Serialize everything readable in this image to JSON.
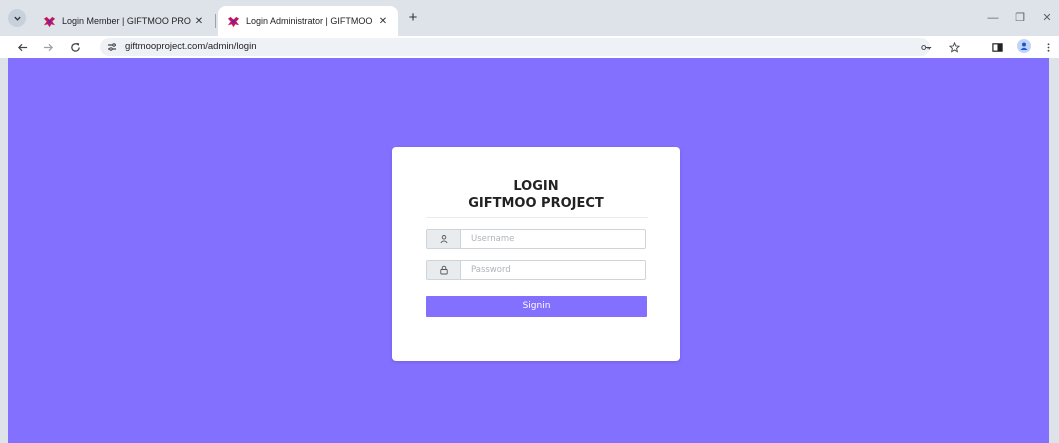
{
  "browser": {
    "tabs": [
      {
        "title": "Login Member | GIFTMOO PRO",
        "active": false,
        "close": "✕"
      },
      {
        "title": "Login Administrator | GIFTMOO",
        "active": true,
        "close": "✕"
      }
    ],
    "new_tab": "+",
    "address": {
      "url": "giftmooproject.com/admin/login"
    },
    "window_controls": {
      "minimize": "—",
      "restore": "❐",
      "close": "✕"
    }
  },
  "login": {
    "title_line1": "LOGIN",
    "title_line2": "GIFTMOO PROJECT",
    "username_placeholder": "Username",
    "password_placeholder": "Password",
    "signin_label": "Signin"
  },
  "colors": {
    "background": "#8370ff",
    "button": "#8370ff",
    "card": "#ffffff"
  },
  "icons": {
    "username_addon": "user-icon",
    "password_addon": "lock-icon"
  }
}
